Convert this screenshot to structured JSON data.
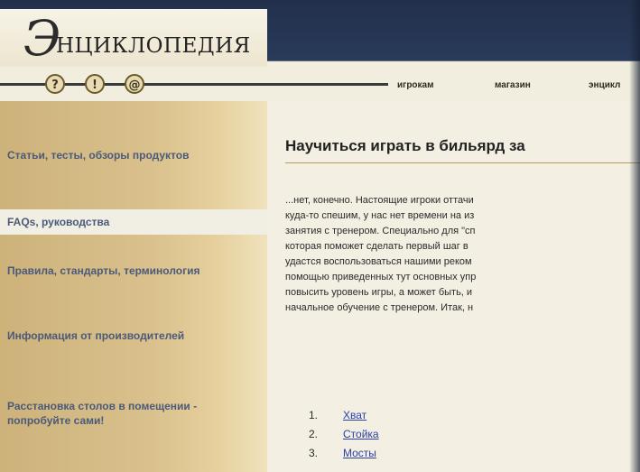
{
  "header": {
    "logo_letter": "Э",
    "logo_word": "НЦИКЛОПЕДИЯ",
    "nav_icons": [
      "?",
      "!",
      "@"
    ],
    "top_links": [
      "игрокам",
      "магазин",
      "энцикл"
    ]
  },
  "sidebar": {
    "items": [
      {
        "label": "Статьи, тесты, обзоры продуктов"
      },
      {
        "label": "FAQs, руководства"
      },
      {
        "label": "Правила, стандарты, терминология"
      },
      {
        "label": "Информация от производителей"
      },
      {
        "label": "Расстановка столов в помещении - попробуйте сами!"
      }
    ]
  },
  "main": {
    "title": "Научиться играть в бильярд за",
    "paragraph_lines": [
      "...нет, конечно. Настоящие игроки оттачи",
      "куда-то спешим, у нас нет времени на из",
      "занятия с тренером. Специально для \"сп",
      "которая поможет сделать первый шаг в",
      "удастся воспользоваться нашими реком",
      "помощью приведенных тут основных упр",
      "повысить уровень игры, а может быть, и",
      "начальное обучение с тренером. Итак, н"
    ],
    "list": [
      {
        "num": "1.",
        "label": "Хват"
      },
      {
        "num": "2.",
        "label": "Стойка"
      },
      {
        "num": "3.",
        "label": "Мосты"
      }
    ]
  },
  "colors": {
    "sidebar_text": "#4a5a78",
    "link": "#2a3fa8",
    "frame": "#1c2a44"
  }
}
